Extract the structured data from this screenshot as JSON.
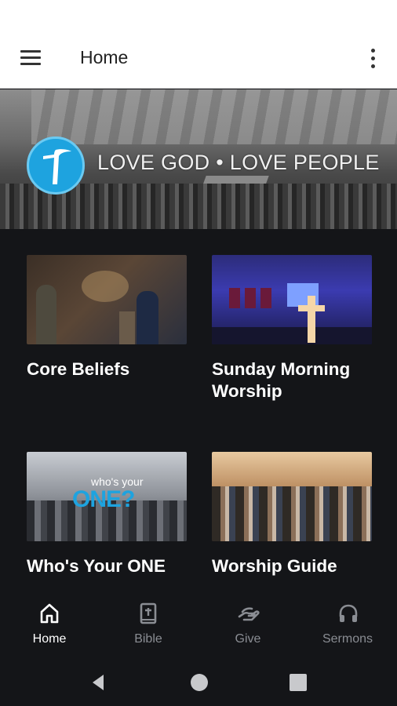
{
  "app_bar": {
    "title": "Home",
    "menu_icon": "hamburger-menu-icon",
    "more_icon": "more-vert-icon"
  },
  "hero": {
    "tagline": "LOVE GOD • LOVE PEOPLE",
    "logo_icon": "cross-logo-icon",
    "accent_color": "#1ea3df"
  },
  "cards": [
    {
      "title": "Core Beliefs"
    },
    {
      "title": "Sunday Morning Worship"
    },
    {
      "title": "Who's Your ONE",
      "thumb_text_small": "who's your",
      "thumb_text_big": "ONE?"
    },
    {
      "title": "Worship Guide"
    }
  ],
  "bottom_nav": {
    "items": [
      {
        "label": "Home",
        "icon": "home-icon",
        "active": true
      },
      {
        "label": "Bible",
        "icon": "bible-icon",
        "active": false
      },
      {
        "label": "Give",
        "icon": "give-hand-icon",
        "active": false
      },
      {
        "label": "Sermons",
        "icon": "headphones-icon",
        "active": false
      }
    ],
    "active_color": "#ffffff",
    "inactive_color": "#8a8d93"
  },
  "system_nav": {
    "back_icon": "back-triangle-icon",
    "home_icon": "home-circle-icon",
    "recents_icon": "recents-square-icon"
  },
  "theme": {
    "background": "#141518",
    "app_bar_background": "#ffffff"
  }
}
